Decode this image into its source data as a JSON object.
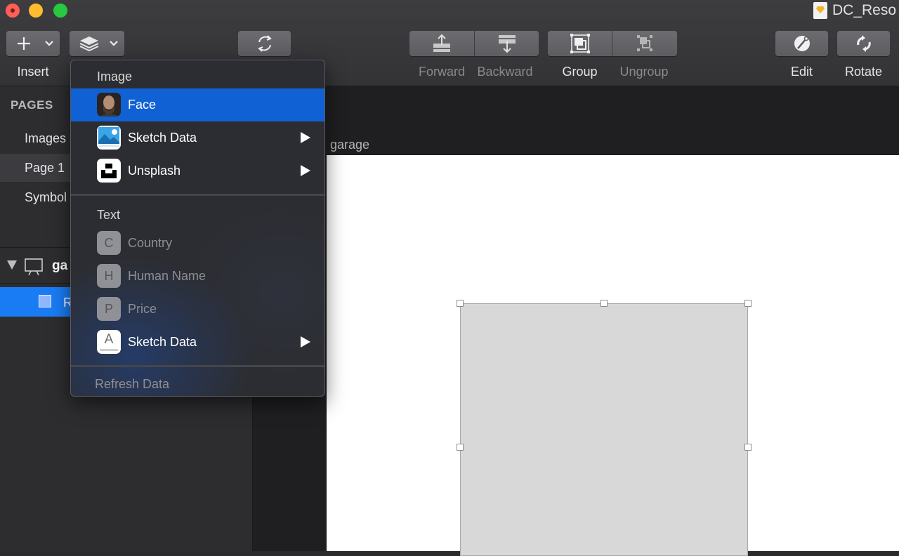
{
  "window": {
    "title": "DC_Reso"
  },
  "toolbar": {
    "insert_label": "Insert",
    "forward_label": "Forward",
    "backward_label": "Backward",
    "group_label": "Group",
    "ungroup_label": "Ungroup",
    "edit_label": "Edit",
    "rotate_label": "Rotate"
  },
  "sidebar": {
    "pages_header": "PAGES",
    "pages": [
      {
        "label": "Images"
      },
      {
        "label": "Page 1"
      },
      {
        "label": "Symbol"
      }
    ],
    "layer_group": "ga",
    "layer_item": "R"
  },
  "canvas": {
    "artboard_label": "garage"
  },
  "menu": {
    "image_section": "Image",
    "image_items": [
      {
        "label": "Face",
        "icon": "face-photo-icon"
      },
      {
        "label": "Sketch Data",
        "icon": "sketch-data-image-icon"
      },
      {
        "label": "Unsplash",
        "icon": "unsplash-icon"
      }
    ],
    "text_section": "Text",
    "text_items": [
      {
        "label": "Country",
        "letter": "C"
      },
      {
        "label": "Human Name",
        "letter": "H"
      },
      {
        "label": "Price",
        "letter": "P"
      },
      {
        "label": "Sketch Data",
        "letter": "A"
      }
    ],
    "refresh_label": "Refresh Data"
  },
  "colors": {
    "accent": "#1a7cf5",
    "menu_highlight": "#1061d4",
    "close": "#fe5f57",
    "minimize": "#febc2e",
    "maximize": "#28c840"
  }
}
